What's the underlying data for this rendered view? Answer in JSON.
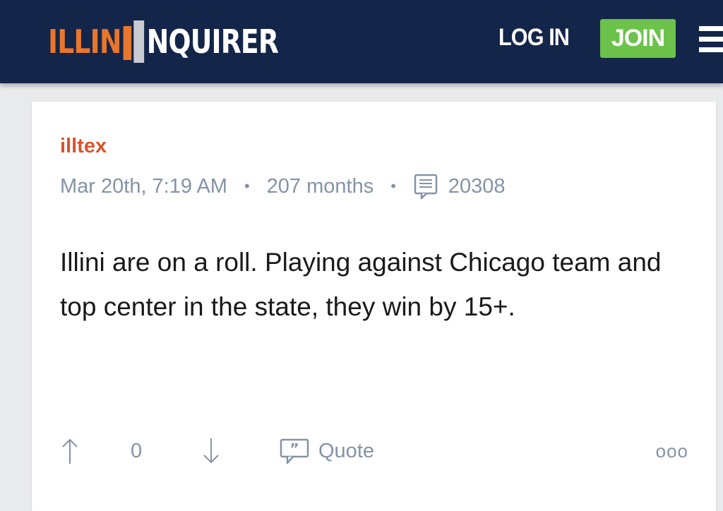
{
  "header": {
    "logo_part1": "ILLIN",
    "logo_part2": "NQUIRER",
    "login_label": "LOG IN",
    "join_label": "JOIN",
    "menu_icon": "hamburger-menu-icon"
  },
  "post": {
    "author": "illtex",
    "timestamp": "Mar 20th, 7:19 AM",
    "tenure": "207 months",
    "post_count": "20308",
    "body": "Illini are on a roll. Playing against Chicago team and top center in the state, they win by 15+.",
    "vote_count": "0",
    "quote_label": "Quote",
    "more_label": "ooo"
  },
  "colors": {
    "header_bg": "#14254a",
    "accent_orange": "#e8762d",
    "join_green": "#6cc24a",
    "author_color": "#d9532c",
    "meta_gray": "#8593a6"
  }
}
